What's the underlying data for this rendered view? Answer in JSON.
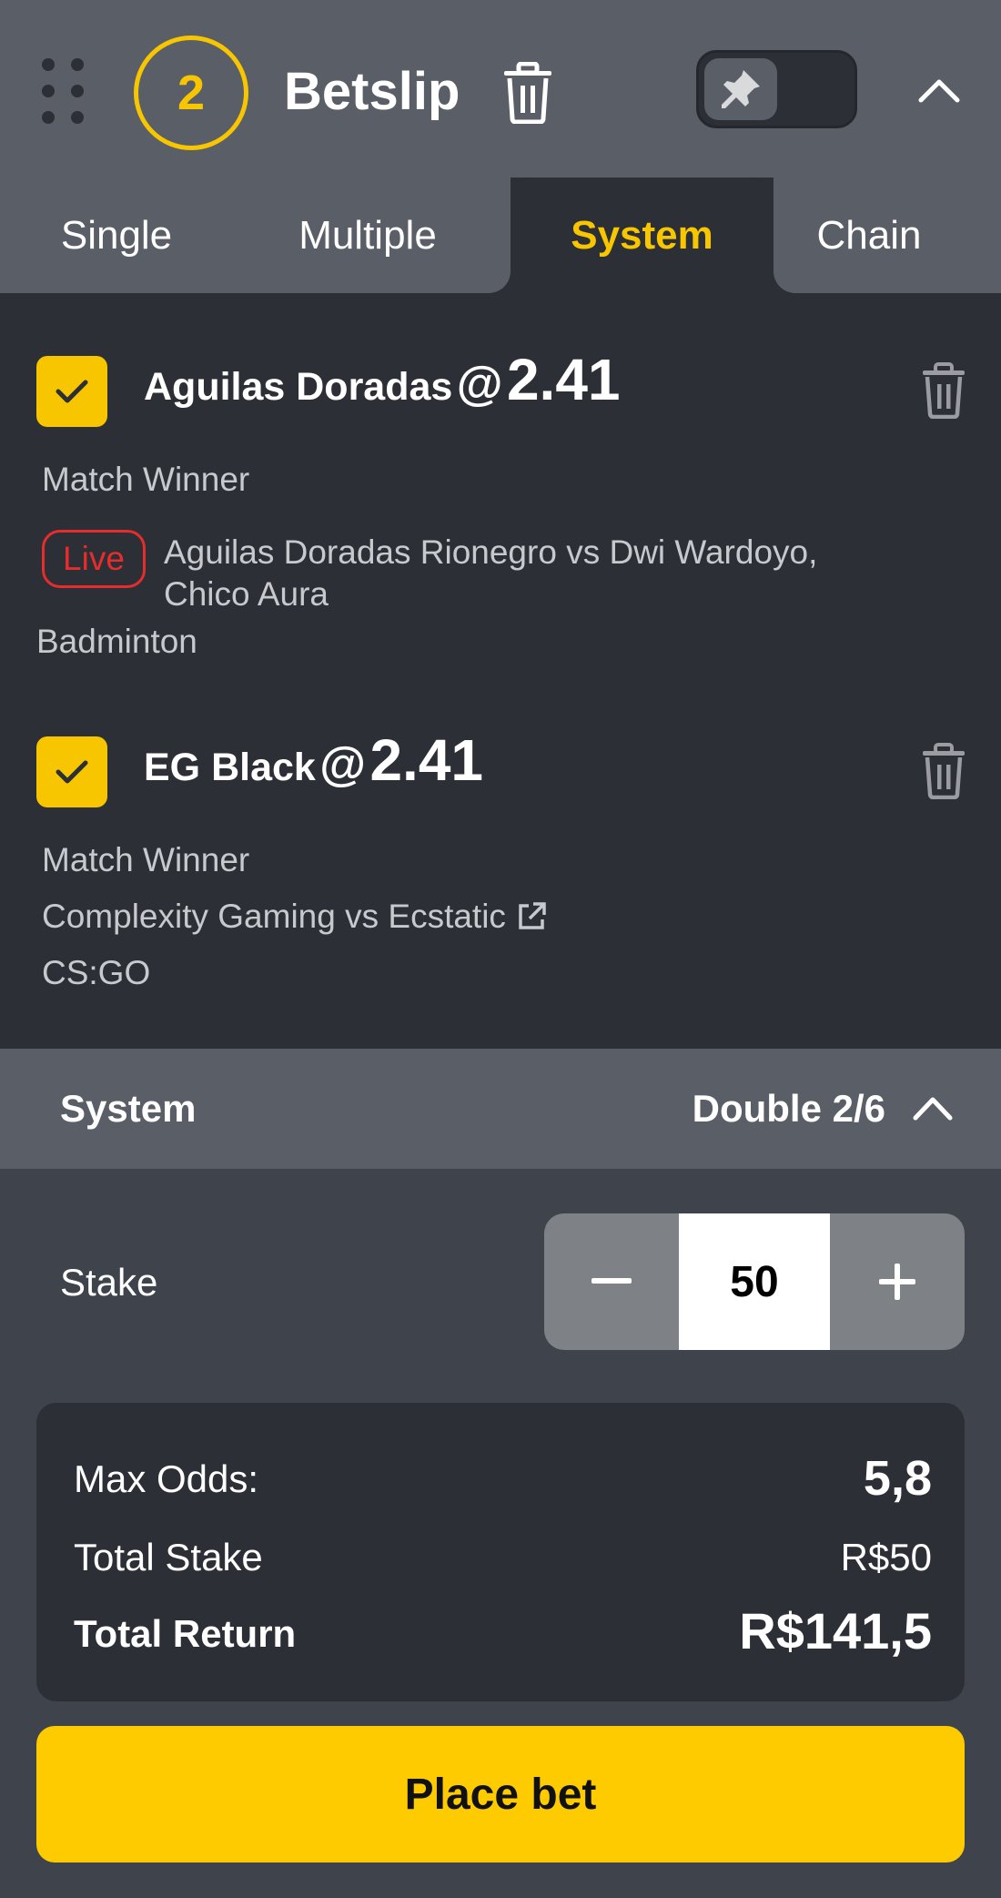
{
  "header": {
    "selection_count": "2",
    "title": "Betslip"
  },
  "tabs": [
    {
      "label": "Single"
    },
    {
      "label": "Multiple"
    },
    {
      "label": "System",
      "active": true
    },
    {
      "label": "Chain"
    }
  ],
  "selections": [
    {
      "team": "Aguilas Doradas",
      "at": "@",
      "odds": "2.41",
      "market": "Match Winner",
      "live_badge": "Live",
      "event": "Aguilas Doradas Rionegro vs Dwi Wardoyo,",
      "event_line2": "Chico Aura",
      "sport": "Badminton",
      "checked": true
    },
    {
      "team": "EG Black",
      "at": "@",
      "odds": "2.41",
      "market": "Match Winner",
      "event": "Complexity Gaming vs Ecstatic",
      "sport": "CS:GO",
      "checked": true
    }
  ],
  "system": {
    "label": "System",
    "value": "Double 2/6"
  },
  "stake": {
    "label": "Stake",
    "value": "50"
  },
  "summary": {
    "max_odds_label": "Max Odds:",
    "max_odds_value": "5,8",
    "total_stake_label": "Total Stake",
    "total_stake_value": "R$50",
    "total_return_label": "Total Return",
    "total_return_value": "R$141,5"
  },
  "place_bet_label": "Place bet",
  "colors": {
    "accent": "#f7c600",
    "live": "#e52d2d",
    "panel_dark": "#2c2f36",
    "panel_mid": "#5a5e66"
  },
  "icons": {
    "drag": "drag-handle-icon",
    "trash": "trash-icon",
    "pin": "pin-icon",
    "chevron": "chevron-up-icon",
    "check": "check-icon",
    "external": "external-link-icon",
    "minus": "minus-icon",
    "plus": "plus-icon"
  }
}
